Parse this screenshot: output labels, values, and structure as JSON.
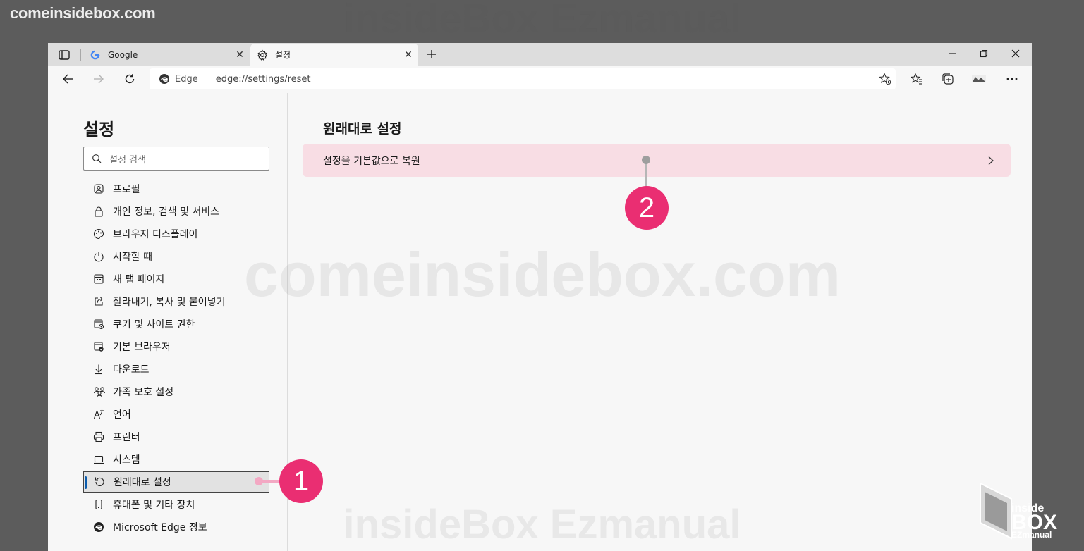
{
  "watermark": {
    "site": "comeinsidebox.com",
    "brand": "insideBox Ezmanual",
    "logo_inside": "inside",
    "logo_box": "BOX",
    "logo_ezmanual": "EZmanual"
  },
  "browser": {
    "tabs": [
      {
        "title": "Google",
        "icon": "google-g-icon"
      },
      {
        "title": "설정",
        "icon": "gear-icon",
        "active": true
      }
    ],
    "close_glyph": "✕",
    "new_tab_glyph": "+",
    "address": {
      "identity": "Edge",
      "url": "edge://settings/reset"
    }
  },
  "sidebar": {
    "title": "설정",
    "search_placeholder": "설정 검색",
    "items": [
      {
        "label": "프로필",
        "icon": "profile-icon"
      },
      {
        "label": "개인 정보, 검색 및 서비스",
        "icon": "lock-icon"
      },
      {
        "label": "브라우저 디스플레이",
        "icon": "palette-icon"
      },
      {
        "label": "시작할 때",
        "icon": "power-icon"
      },
      {
        "label": "새 탭 페이지",
        "icon": "new-tab-page-icon"
      },
      {
        "label": "잘라내기, 복사 및 붙여넣기",
        "icon": "share-icon"
      },
      {
        "label": "쿠키 및 사이트 권한",
        "icon": "site-permissions-icon"
      },
      {
        "label": "기본 브라우저",
        "icon": "default-browser-icon"
      },
      {
        "label": "다운로드",
        "icon": "download-icon"
      },
      {
        "label": "가족 보호 설정",
        "icon": "family-icon"
      },
      {
        "label": "언어",
        "icon": "language-icon"
      },
      {
        "label": "프린터",
        "icon": "printer-icon"
      },
      {
        "label": "시스템",
        "icon": "laptop-icon"
      },
      {
        "label": "원래대로 설정",
        "icon": "reset-icon",
        "active": true
      },
      {
        "label": "휴대폰 및 기타 장치",
        "icon": "phone-icon"
      },
      {
        "label": "Microsoft Edge 정보",
        "icon": "edge-logo-icon"
      }
    ]
  },
  "main": {
    "title": "원래대로 설정",
    "reset_row_label": "설정을 기본값으로 복원"
  },
  "callouts": {
    "one": "1",
    "two": "2"
  },
  "colors": {
    "accent": "#0b5cad",
    "callout": "#ea2e72",
    "row_highlight": "#f8dde4"
  }
}
